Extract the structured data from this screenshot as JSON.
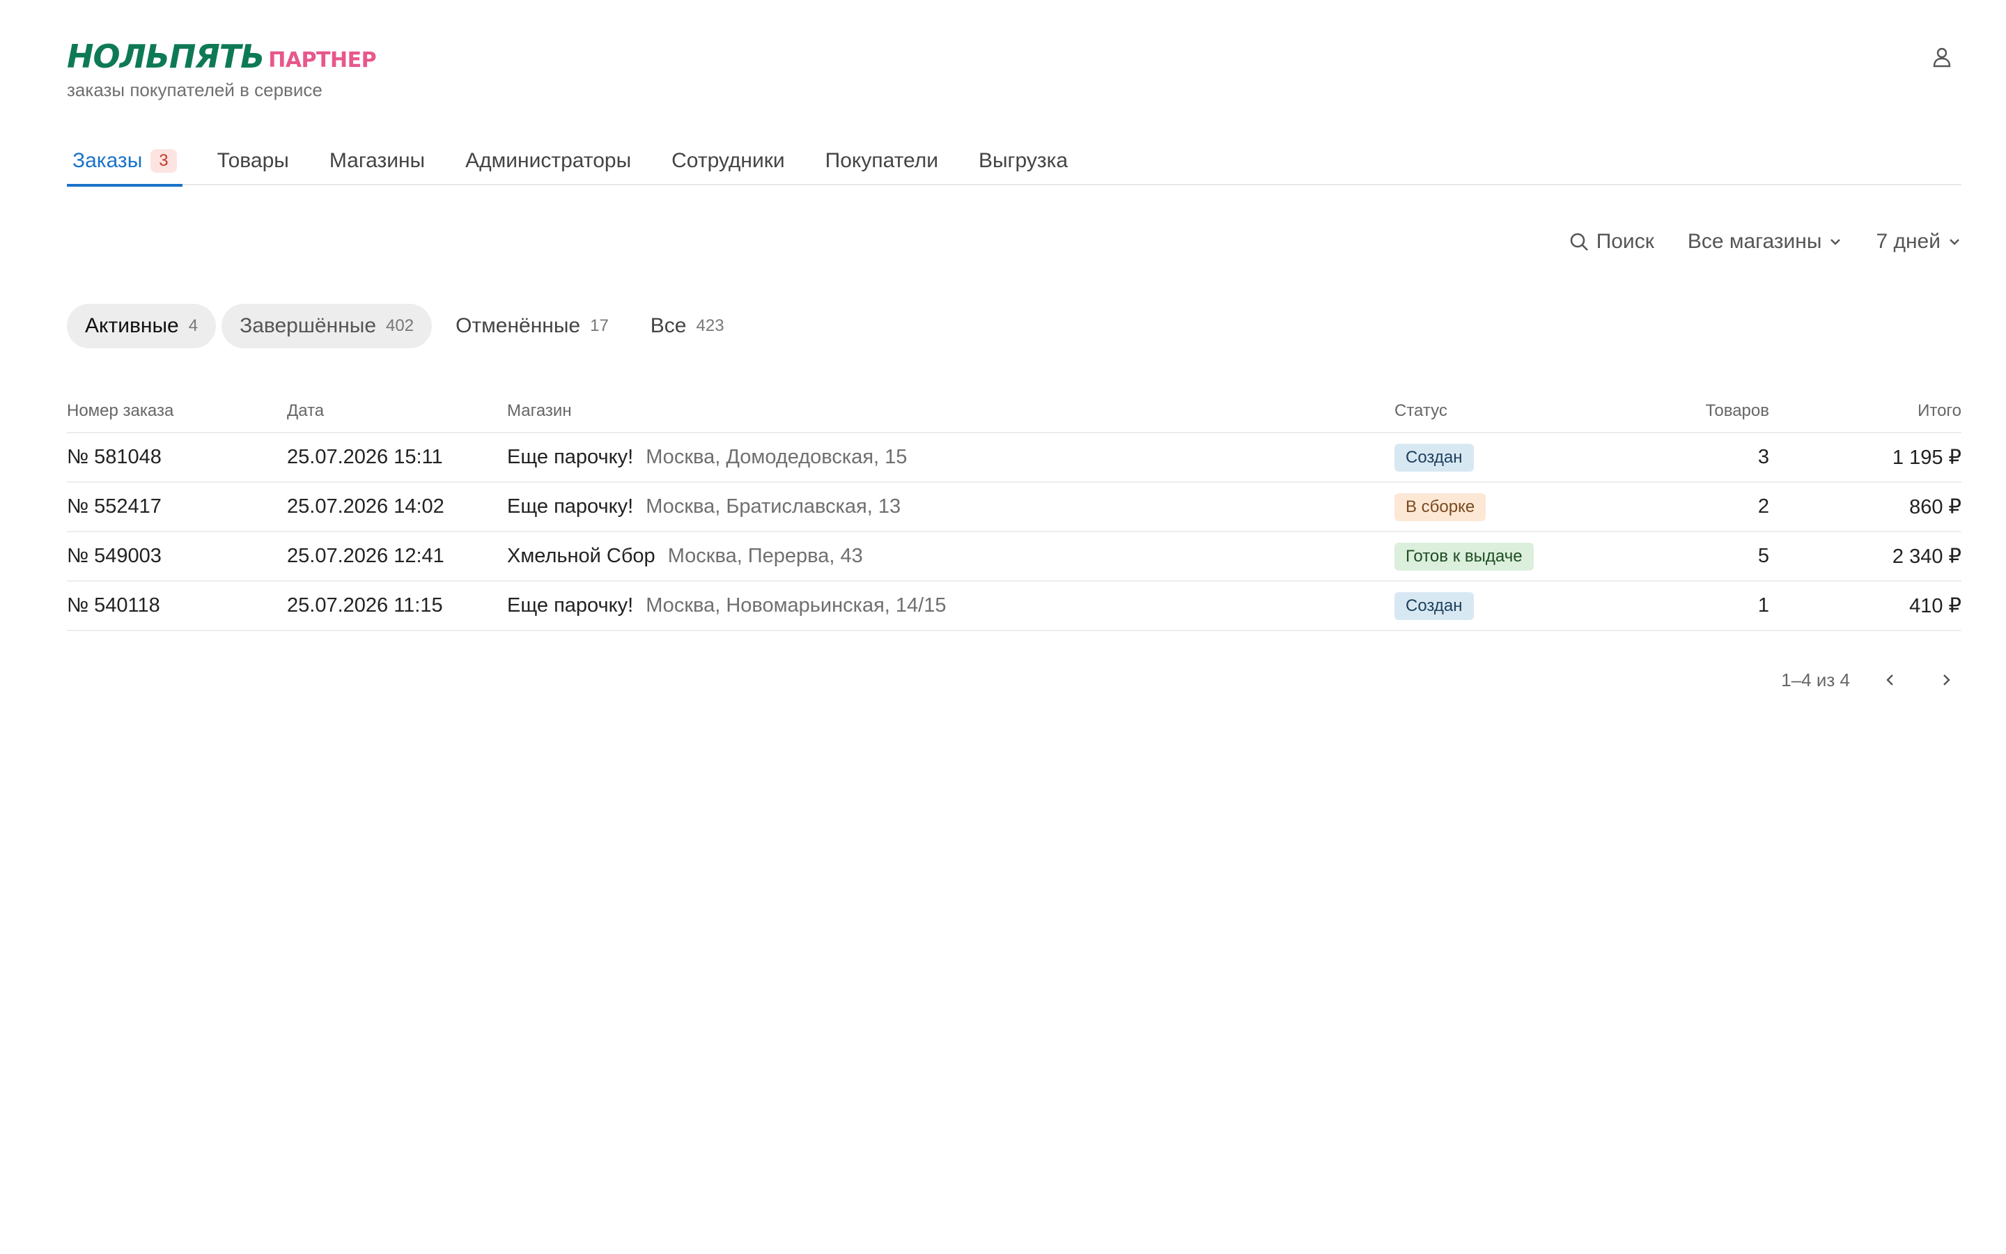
{
  "header": {
    "logo_brand": "НОЛЬПЯТЬ",
    "logo_sub": "ПАРТНЕР",
    "tagline": "заказы покупателей в сервисе",
    "user_icon": "user-icon"
  },
  "nav": {
    "items": [
      {
        "label": "Заказы",
        "badge": "3",
        "active": true
      },
      {
        "label": "Товары"
      },
      {
        "label": "Магазины"
      },
      {
        "label": "Администраторы"
      },
      {
        "label": "Сотрудники"
      },
      {
        "label": "Покупатели"
      },
      {
        "label": "Выгрузка"
      }
    ]
  },
  "filters": {
    "search_label": "Поиск",
    "search_icon": "search-icon",
    "store_label": "Все магазины",
    "period_label": "7 дней",
    "chevron_icon": "chevron-down-icon"
  },
  "segments": [
    {
      "label": "Активные",
      "count": "4"
    },
    {
      "label": "Завершённые",
      "count": "402"
    },
    {
      "label": "Отменённые",
      "count": "17"
    },
    {
      "label": "Все",
      "count": "423"
    }
  ],
  "table": {
    "columns": [
      "Номер заказа",
      "Дата",
      "Магазин",
      "Статус",
      "Товаров",
      "Итого"
    ],
    "rows": [
      {
        "number": "№ 581048",
        "date": "25.07.2026 15:11",
        "store": "Еще парочку!",
        "address": "Москва, Домодедовская, 15",
        "status": "Создан",
        "status_bg": "#d8e8f3",
        "status_fg": "#1d3f5a",
        "items": "3",
        "total": "1 195 ₽"
      },
      {
        "number": "№ 552417",
        "date": "25.07.2026 14:02",
        "store": "Еще парочку!",
        "address": "Москва, Братиславская, 13",
        "status": "В сборке",
        "status_bg": "#fde8d6",
        "status_fg": "#7a4a1e",
        "items": "2",
        "total": "860 ₽"
      },
      {
        "number": "№ 549003",
        "date": "25.07.2026 12:41",
        "store": "Хмельной Сбор",
        "address": "Москва, Перерва, 43",
        "status": "Готов к выдаче",
        "status_bg": "#dbefdc",
        "status_fg": "#1f4d23",
        "items": "5",
        "total": "2 340 ₽"
      },
      {
        "number": "№ 540118",
        "date": "25.07.2026 11:15",
        "store": "Еще парочку!",
        "address": "Москва, Новомарьинская, 14/15",
        "status": "Создан",
        "status_bg": "#d8e8f3",
        "status_fg": "#1d3f5a",
        "items": "1",
        "total": "410 ₽"
      }
    ]
  },
  "pager": {
    "range": "1–4 из 4",
    "prev_icon": "chevron-left-icon",
    "next_icon": "chevron-right-icon"
  },
  "colors": {
    "accent": "#1a73c8",
    "brand_green": "#0e7a55",
    "brand_pink": "#e8578c"
  }
}
